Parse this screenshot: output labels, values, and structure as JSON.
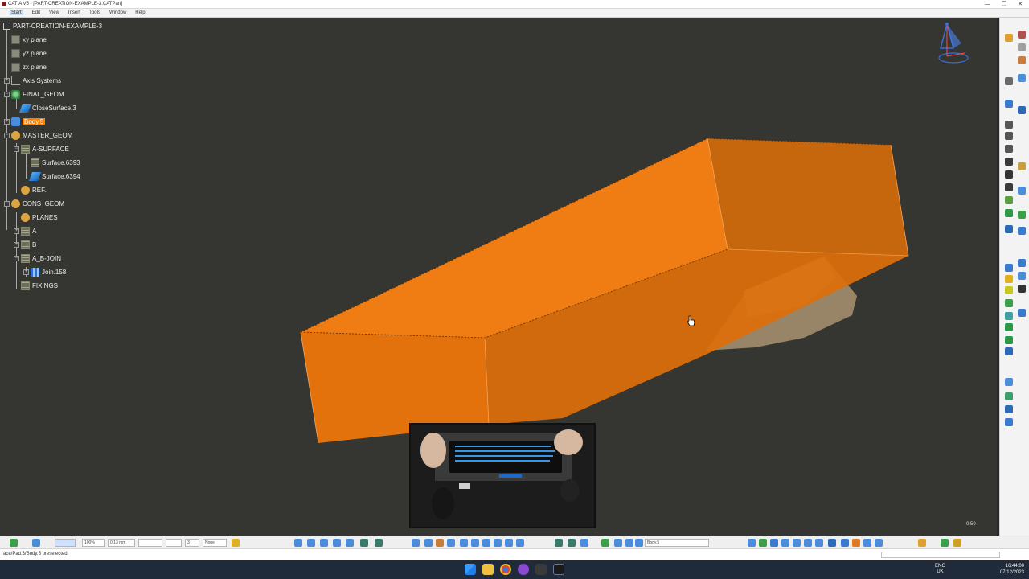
{
  "window": {
    "title": "CATIA V5 - [PART-CREATION-EXAMPLE-3.CATPart]",
    "controls": [
      "—",
      "❐",
      "✕"
    ]
  },
  "menu": [
    "Start",
    "Edit",
    "View",
    "Insert",
    "Tools",
    "Window",
    "Help"
  ],
  "tree": {
    "root": "PART-CREATION-EXAMPLE-3",
    "items": [
      {
        "label": "xy plane"
      },
      {
        "label": "yz plane"
      },
      {
        "label": "zx plane"
      },
      {
        "label": "Axis Systems"
      },
      {
        "label": "FINAL_GEOM"
      },
      {
        "label": "CloseSurface.3"
      },
      {
        "label": "Body.5"
      },
      {
        "label": "MASTER_GEOM"
      },
      {
        "label": "A-SURFACE"
      },
      {
        "label": "Surface.6393"
      },
      {
        "label": "Surface.6394"
      },
      {
        "label": "REF."
      },
      {
        "label": "CONS_GEOM"
      },
      {
        "label": "PLANES"
      },
      {
        "label": "A"
      },
      {
        "label": "B"
      },
      {
        "label": "A_B-JOIN"
      },
      {
        "label": "Join.158"
      },
      {
        "label": "FIXINGS"
      }
    ]
  },
  "bottom_toolbar": {
    "zoom": "100%",
    "thickness": "0.13 mm",
    "layer_number": "3",
    "layer_filter": "None",
    "current_body": "Body.5"
  },
  "status": {
    "message": "ace/Pad.3/Body.5 preselected"
  },
  "scale": "0.50",
  "taskbar": {
    "lang_line1": "ENG",
    "lang_line2": "UK",
    "time": "16:44:00",
    "date": "07/12/2023"
  },
  "colors": {
    "viewport": "#353532",
    "selection": "#ff7f00",
    "solid_top": "#ef7b10",
    "solid_front": "#e2720c",
    "solid_side": "#d46a0a"
  }
}
